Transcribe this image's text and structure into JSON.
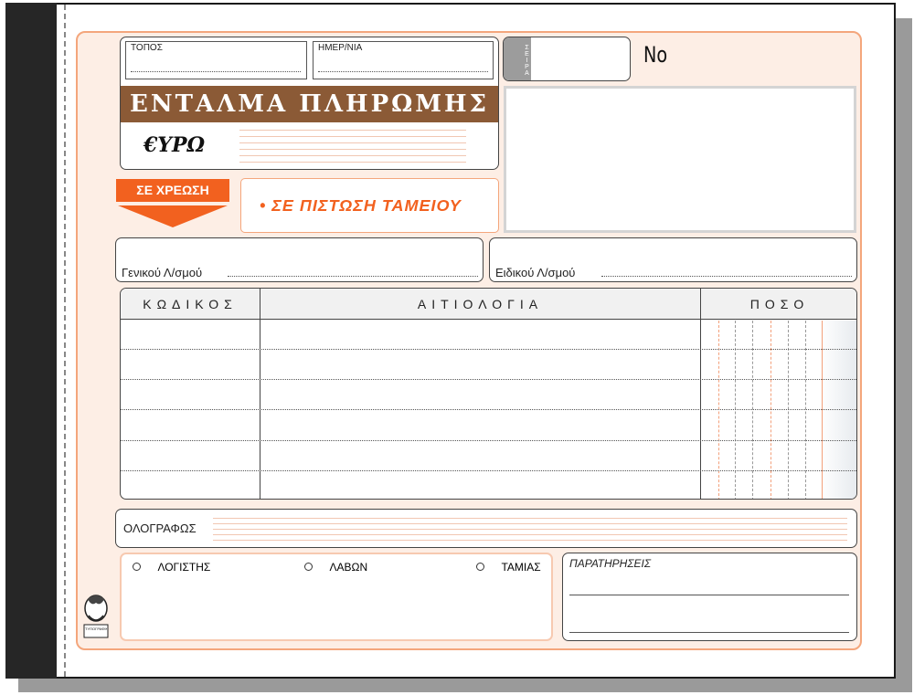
{
  "form": {
    "place_label": "ΤΟΠΟΣ",
    "date_label": "ΗΜΕΡ/ΝΙΑ",
    "series_label": "ΣΕΙΡΑ",
    "number_label": "No",
    "title": "ΕΝΤΑΛΜΑ ΠΛΗΡΩΜΗΣ",
    "currency": "€ΥΡΩ",
    "debit_tab": "ΣΕ ΧΡΕΩΣΗ",
    "credit_text": "• ΣΕ ΠΙΣΤΩΣΗ ΤΑΜΕΙΟΥ",
    "general_ledger_label": "Γενικού Λ/σμού",
    "special_ledger_label": "Ειδικού Λ/σμού",
    "amount_in_words_label": "ΟΛΟΓΡΑΦΩΣ",
    "remarks_label": "ΠΑΡΑΤΗΡΗΣΕΙΣ"
  },
  "table": {
    "columns": [
      "ΚΩΔΙΚΟΣ",
      "ΑΙΤΙΟΛΟΓΙΑ",
      "ΠΟΣΟ"
    ]
  },
  "signatures": [
    {
      "label": "ΛΟΓΙΣΤΗΣ"
    },
    {
      "label": "ΛΑΒΩΝ"
    },
    {
      "label": "ΤΑΜΙΑΣ"
    }
  ],
  "logo": {
    "text": "ΤΥΠΟΓΡΑΦΙΚΟ"
  },
  "colors": {
    "accent_orange": "#f2611f",
    "title_brown": "#8b5a36",
    "form_tint": "#fdeee5",
    "border_salmon": "#f4a67c"
  }
}
